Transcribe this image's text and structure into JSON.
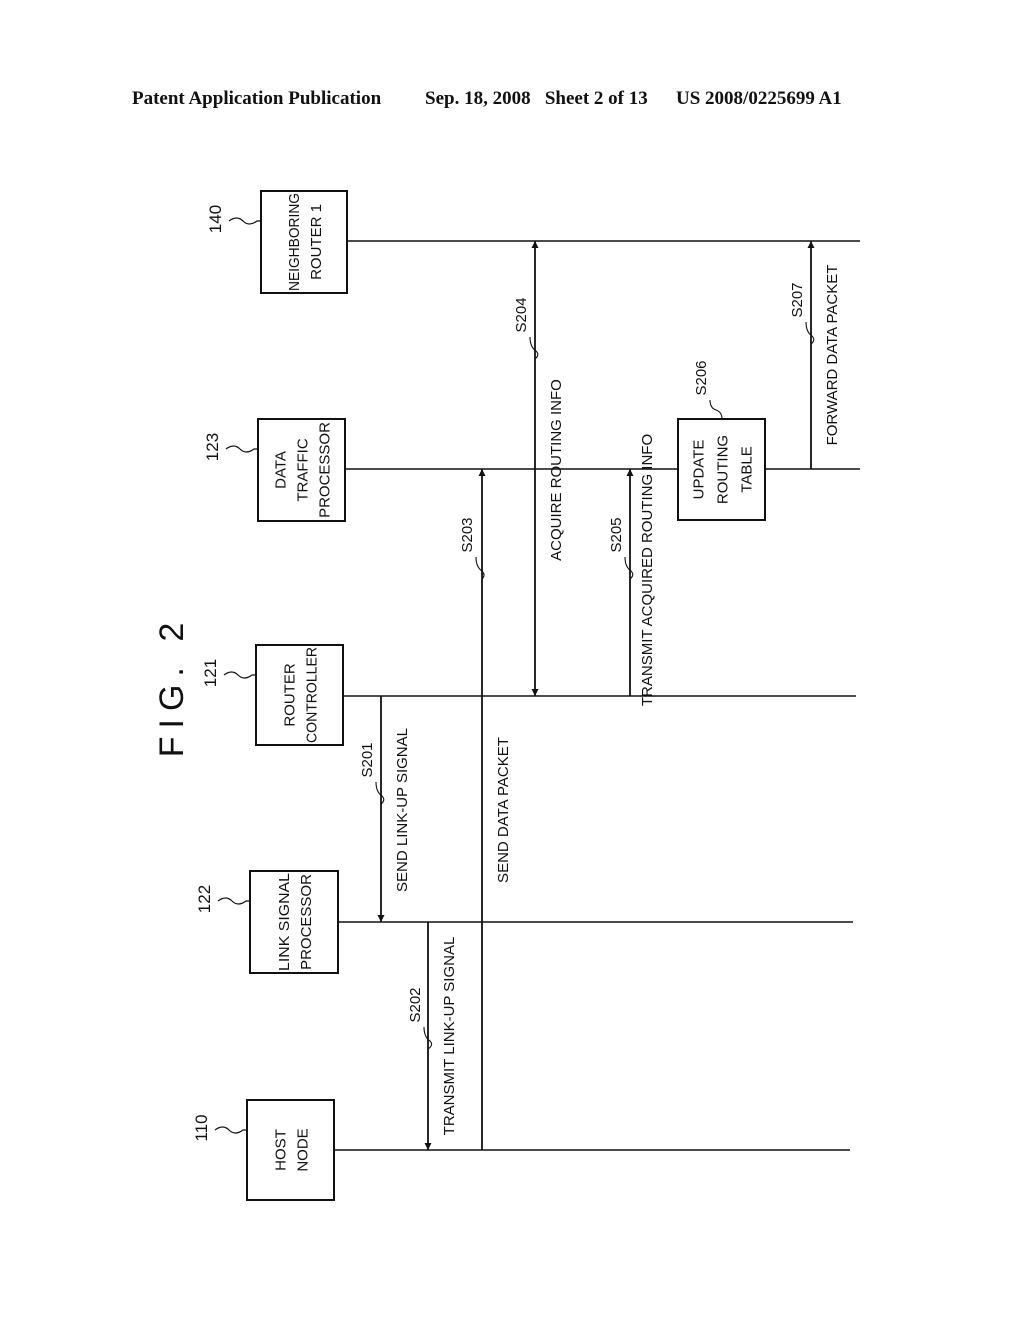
{
  "header": {
    "publication": "Patent Application Publication",
    "date_sheet": "Sep. 18, 2008   Sheet 2 of 13",
    "patent_number": "US 2008/0225699 A1"
  },
  "figure": {
    "title": "FIG. 2",
    "lifelines": [
      {
        "ref": "140",
        "label_lines": [
          "NEIGHBORING",
          "ROUTER 1"
        ]
      },
      {
        "ref": "123",
        "label_lines": [
          "DATA",
          "TRAFFIC",
          "PROCESSOR"
        ]
      },
      {
        "ref": "121",
        "label_lines": [
          "ROUTER",
          "CONTROLLER"
        ]
      },
      {
        "ref": "122",
        "label_lines": [
          "LINK SIGNAL",
          "PROCESSOR"
        ]
      },
      {
        "ref": "110",
        "label_lines": [
          "HOST",
          "NODE"
        ]
      }
    ],
    "messages": [
      {
        "step": "S201",
        "label": "SEND LINK-UP SIGNAL",
        "from": "121",
        "to": "122",
        "direction": "forward"
      },
      {
        "step": "S202",
        "label": "TRANSMIT LINK-UP SIGNAL",
        "from": "122",
        "to": "110",
        "direction": "forward"
      },
      {
        "step": "S203",
        "label": "SEND DATA PACKET",
        "from": "110",
        "to": "123",
        "direction": "forward"
      },
      {
        "step": "S204",
        "label": "ACQUIRE ROUTING INFO",
        "from": "121",
        "to": "140",
        "direction": "both"
      },
      {
        "step": "S205",
        "label": "TRANSMIT ACQUIRED ROUTING INFO",
        "from": "121",
        "to": "123",
        "direction": "forward"
      },
      {
        "step": "S207",
        "label": "FORWARD DATA PACKET",
        "from": "123",
        "to": "140",
        "direction": "forward"
      }
    ],
    "process": {
      "step": "S206",
      "label_lines": [
        "UPDATE",
        "ROUTING",
        "TABLE"
      ],
      "on": "123"
    }
  }
}
